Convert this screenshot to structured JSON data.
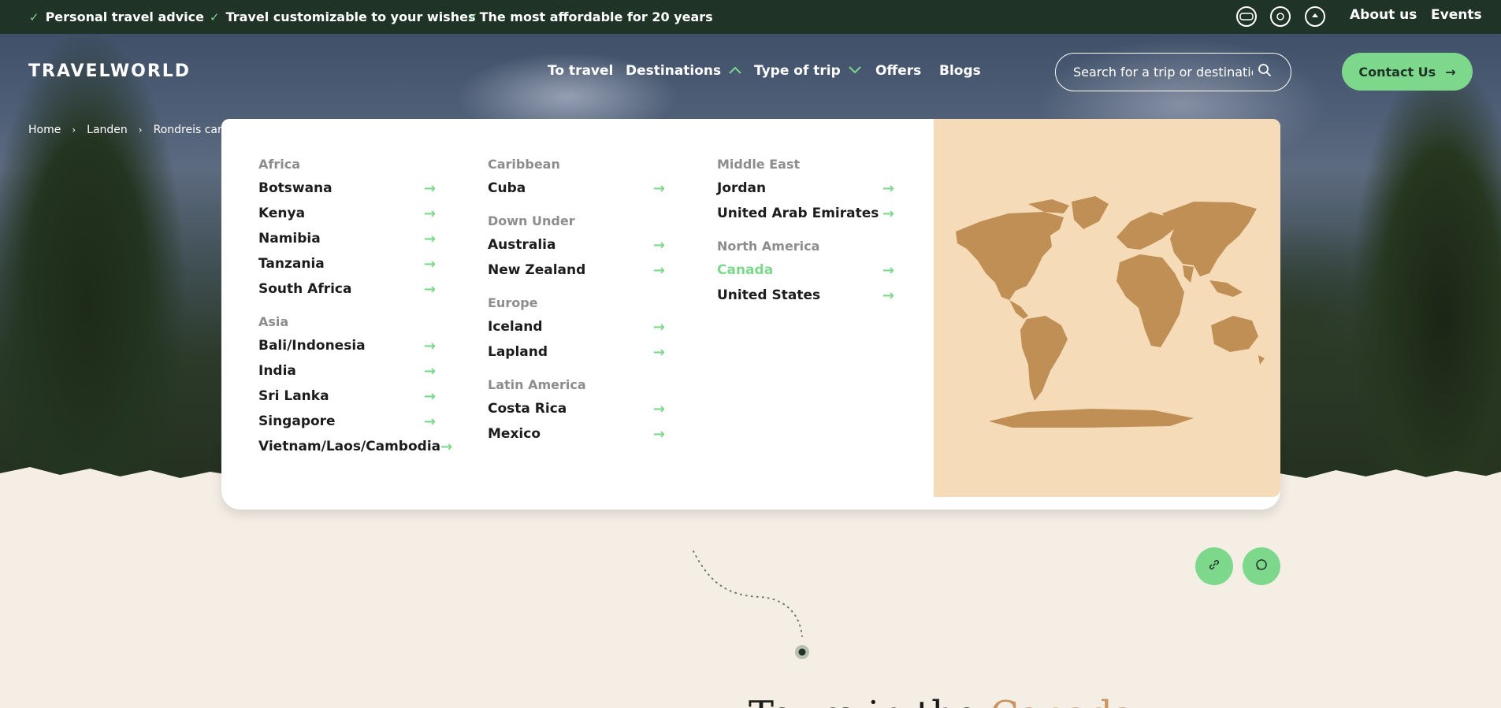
{
  "topbar": {
    "usps": [
      "Personal travel advice",
      "Travel customizable to your wishes",
      "The most affordable for 20 years"
    ],
    "links": [
      "About us",
      "Events"
    ],
    "badges": [
      "anvr-badge-icon",
      "sgr-badge-icon",
      "travel-badge-icon"
    ]
  },
  "header": {
    "logo": "TRAVELWORLD",
    "nav": [
      "To travel",
      "Destinations",
      "Type of trip",
      "Offers",
      "Blogs"
    ],
    "search_placeholder": "Search for a trip or destination",
    "contact_label": "Contact Us"
  },
  "breadcrumb": [
    "Home",
    "Landen",
    "Rondreis canad"
  ],
  "menu": {
    "columns": [
      {
        "groups": [
          {
            "region": "Africa",
            "items": [
              "Botswana",
              "Kenya",
              "Namibia",
              "Tanzania",
              "South Africa"
            ]
          },
          {
            "region": "Asia",
            "items": [
              "Bali/Indonesia",
              "India",
              "Sri Lanka",
              "Singapore",
              "Vietnam/Laos/Cambodia"
            ]
          }
        ]
      },
      {
        "groups": [
          {
            "region": "Caribbean",
            "items": [
              "Cuba"
            ]
          },
          {
            "region": "Down Under",
            "items": [
              "Australia",
              "New Zealand"
            ]
          },
          {
            "region": "Europe",
            "items": [
              "Iceland",
              "Lapland"
            ]
          },
          {
            "region": "Latin America",
            "items": [
              "Costa Rica",
              "Mexico"
            ]
          }
        ]
      },
      {
        "groups": [
          {
            "region": "Middle East",
            "items": [
              "Jordan",
              "United Arab Emirates"
            ]
          },
          {
            "region": "North America",
            "items": [
              "Canada",
              "United States"
            ]
          }
        ]
      }
    ],
    "active_item": "Canada"
  },
  "colors": {
    "accent": "#7dd88c",
    "dark": "#1f3326",
    "map_bg": "#f5dbb8",
    "map_land": "#c08f55",
    "page_bg": "#f4eee5"
  },
  "share": [
    "link-icon",
    "whatsapp-icon"
  ],
  "title_peek": {
    "text": "Tours in the ",
    "accent": "Canada"
  }
}
